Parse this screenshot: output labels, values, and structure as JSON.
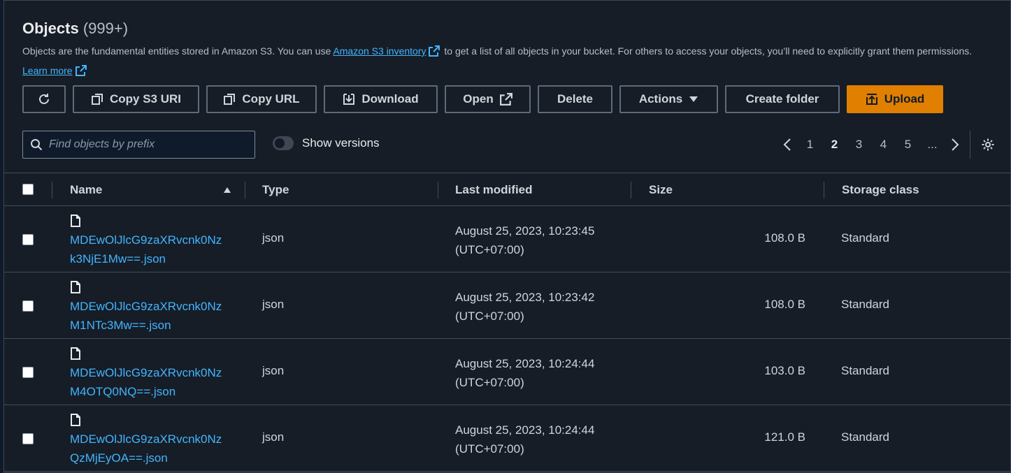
{
  "header": {
    "title": "Objects",
    "count": "(999+)",
    "desc_part1": "Objects are the fundamental entities stored in Amazon S3. You can use ",
    "inventory_link": "Amazon S3 inventory",
    "desc_part2": " to get a list of all objects in your bucket. For others to access your objects, you’ll need to explicitly grant them permissions. ",
    "learn_more": "Learn more"
  },
  "toolbar": {
    "copy_s3_uri": "Copy S3 URI",
    "copy_url": "Copy URL",
    "download": "Download",
    "open": "Open",
    "delete": "Delete",
    "actions": "Actions",
    "create_folder": "Create folder",
    "upload": "Upload"
  },
  "search": {
    "placeholder": "Find objects by prefix"
  },
  "toggle": {
    "label": "Show versions"
  },
  "pagination": {
    "pages": [
      "1",
      "2",
      "3",
      "4",
      "5",
      "..."
    ],
    "current": "2"
  },
  "table": {
    "columns": {
      "name": "Name",
      "type": "Type",
      "last_modified": "Last modified",
      "size": "Size",
      "storage_class": "Storage class"
    },
    "rows": [
      {
        "name_line1": "MDEwOlJlcG9zaXRvcnk0Nz",
        "name_line2": "k3NjE1Mw==.json",
        "type": "json",
        "modified_date": "August 25, 2023, 10:23:45",
        "modified_tz": "(UTC+07:00)",
        "size": "108.0 B",
        "storage": "Standard"
      },
      {
        "name_line1": "MDEwOlJlcG9zaXRvcnk0Nz",
        "name_line2": "M1NTc3Mw==.json",
        "type": "json",
        "modified_date": "August 25, 2023, 10:23:42",
        "modified_tz": "(UTC+07:00)",
        "size": "108.0 B",
        "storage": "Standard"
      },
      {
        "name_line1": "MDEwOlJlcG9zaXRvcnk0Nz",
        "name_line2": "M4OTQ0NQ==.json",
        "type": "json",
        "modified_date": "August 25, 2023, 10:24:44",
        "modified_tz": "(UTC+07:00)",
        "size": "103.0 B",
        "storage": "Standard"
      },
      {
        "name_line1": "MDEwOlJlcG9zaXRvcnk0Nz",
        "name_line2": "QzMjEyOA==.json",
        "type": "json",
        "modified_date": "August 25, 2023, 10:24:44",
        "modified_tz": "(UTC+07:00)",
        "size": "121.0 B",
        "storage": "Standard"
      }
    ]
  },
  "colors": {
    "accent": "#e07f00",
    "link": "#42b4ff",
    "background": "#161d26"
  }
}
